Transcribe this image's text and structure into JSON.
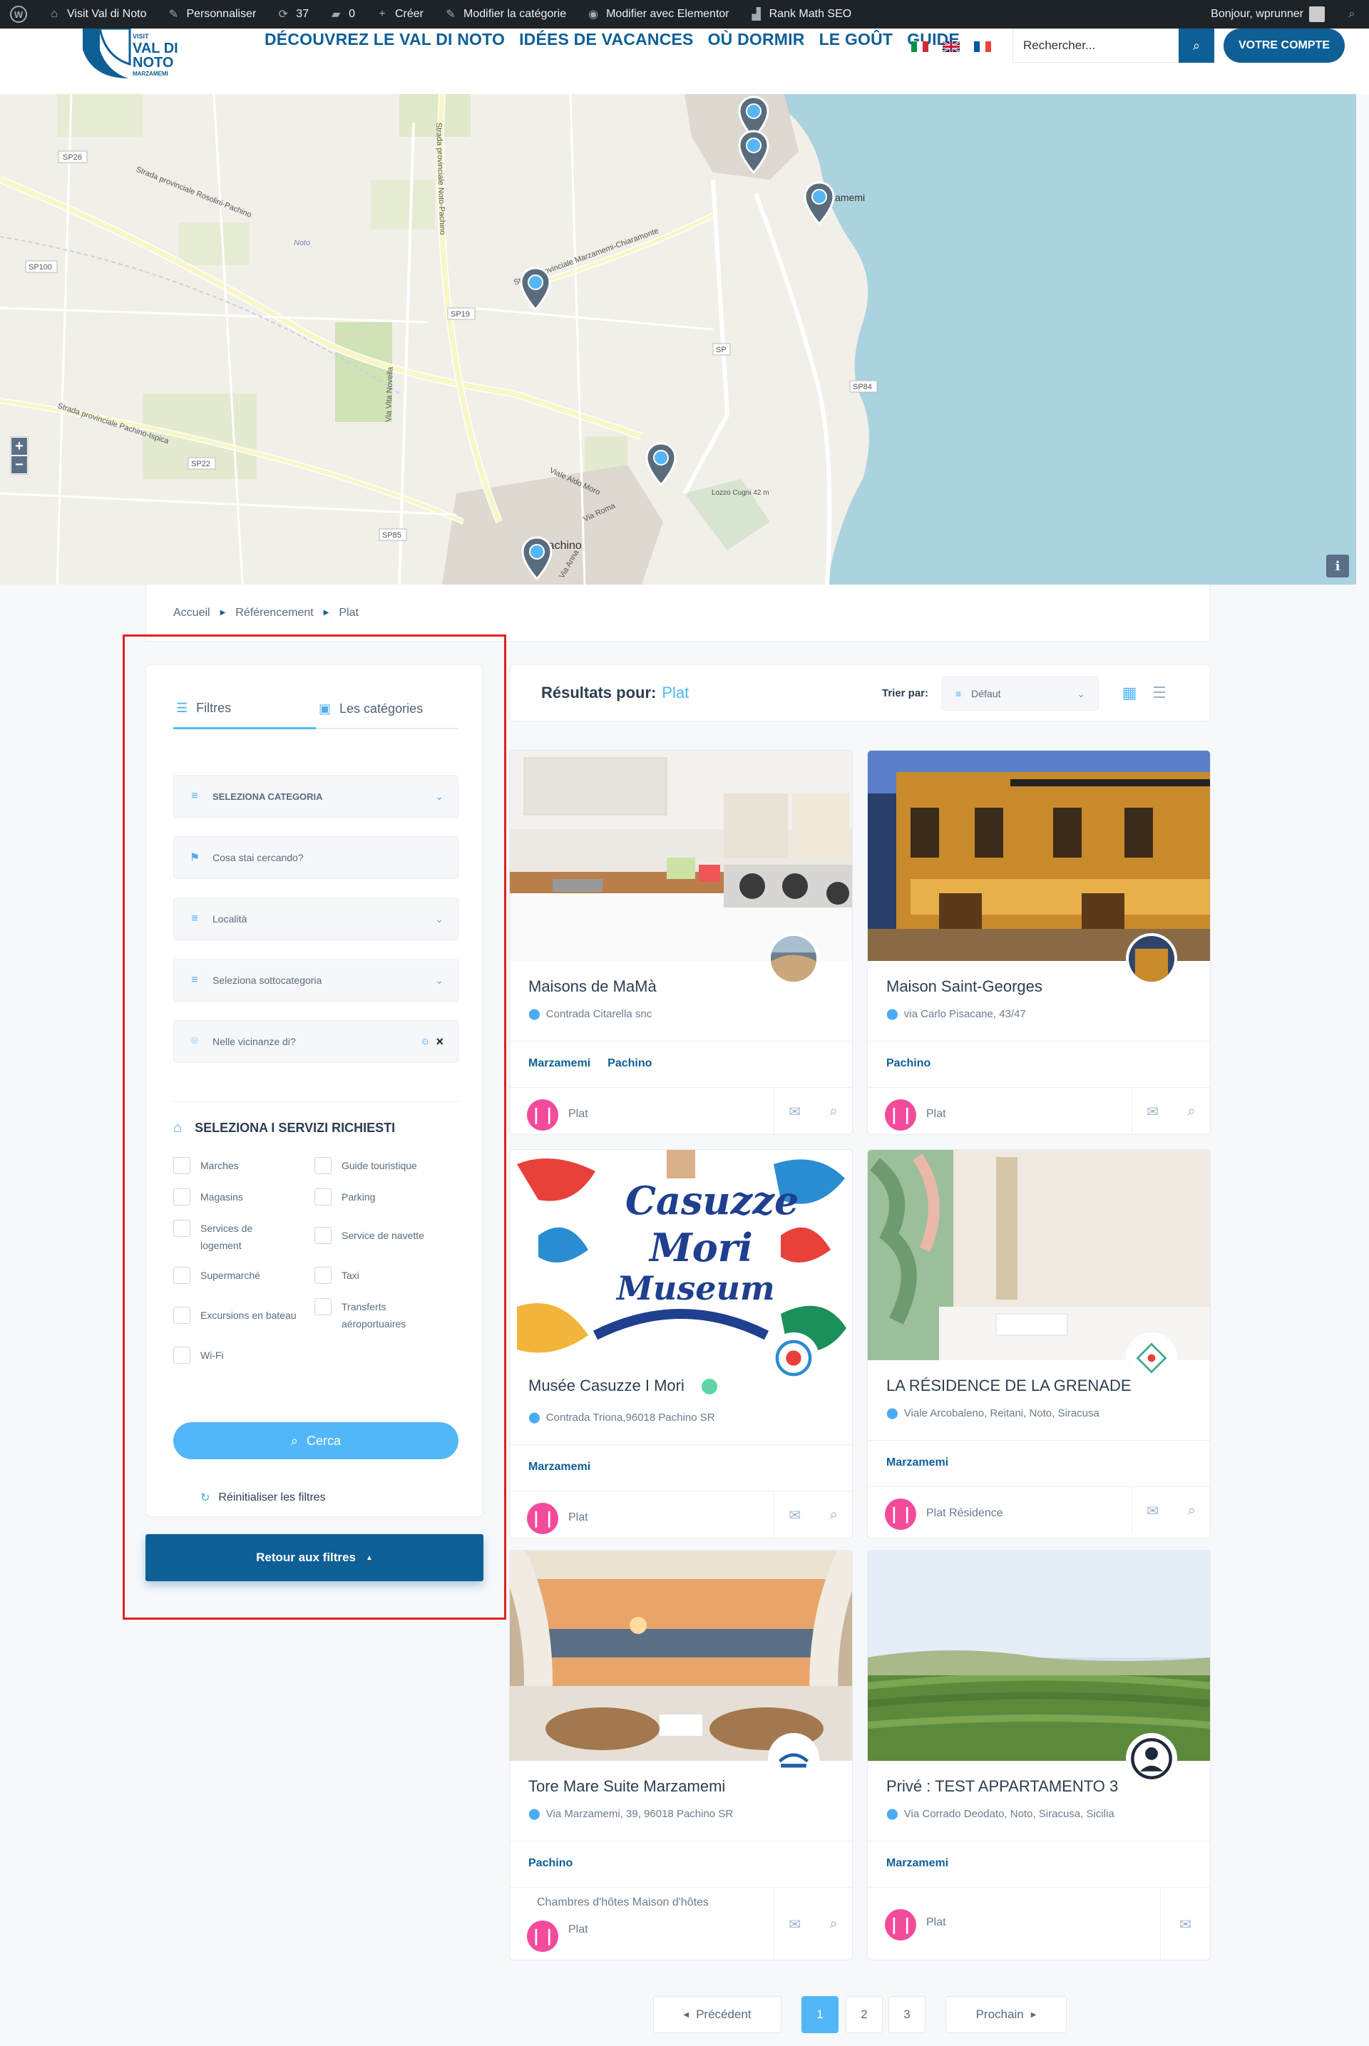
{
  "adminbar": {
    "site": "Visit Val di Noto",
    "customize": "Personnaliser",
    "updates": "37",
    "comments": "0",
    "create": "Créer",
    "edit_category": "Modifier la catégorie",
    "edit_elementor": "Modifier avec Elementor",
    "rank_math": "Rank Math SEO",
    "greeting": "Bonjour, wprunner"
  },
  "header": {
    "logo_top": "VISIT",
    "logo_main1": "VAL DI",
    "logo_main2": "NOTO",
    "logo_sub": "MARZAMEMI",
    "nav": [
      "DÉCOUVREZ LE VAL DI NOTO",
      "IDÉES DE VACANCES",
      "OÙ DORMIR",
      "LE GOÛT",
      "GUIDE"
    ],
    "search_placeholder": "Rechercher...",
    "account": "VOTRE COMPTE"
  },
  "map": {
    "labels": [
      "SP26",
      "SP100",
      "SP19",
      "SP22",
      "SP85",
      "SP",
      "SP84",
      "Noto",
      "Marzamemi",
      "Pachino",
      "Strada provinciale Rosolini-Pachino",
      "Strada provinciale Noto-Pachino",
      "Strada provinciale Marzamemi-Chiaramonte",
      "Strada provinciale Pachino-Ispica",
      "Via Vita Novella",
      "Viale Aldo Moro",
      "Via Roma",
      "Via Anna",
      "Lozzo Cugni 42 m"
    ],
    "zoom_in": "+",
    "zoom_out": "−",
    "info": "i"
  },
  "breadcrumb": [
    "Accueil",
    "Référencement",
    "Plat"
  ],
  "sidebar": {
    "tab_filters": "Filtres",
    "tab_categories": "Les catégories",
    "category_select": "SELEZIONA CATEGORIA",
    "keyword_placeholder": "Cosa stai cercando?",
    "location_select": "Località",
    "subcategory_select": "Seleziona sottocategoria",
    "near_placeholder": "Nelle vicinanze di?",
    "services_title": "SELEZIONA I SERVIZI RICHIESTI",
    "services": [
      "Marches",
      "Guide touristique",
      "Magasins",
      "Parking",
      "Services de logement",
      "Service de navette",
      "Supermarché",
      "Taxi",
      "Excursions en bateau",
      "Transferts aéroportuaires",
      "Wi-Fi"
    ],
    "search_button": "Cerca",
    "reset": "Réinitialiser les filtres",
    "back_button": "Retour aux filtres"
  },
  "results": {
    "label": "Résultats pour:",
    "category": "Plat",
    "sort_label": "Trier par:",
    "sort_value": "Défaut"
  },
  "cards": [
    {
      "title": "Maisons de MaMà",
      "address": "Contrada Citarella snc",
      "locations": [
        "Marzamemi",
        "Pachino"
      ],
      "categories": "Plat"
    },
    {
      "title": "Maison Saint-Georges",
      "address": "via Carlo Pisacane, 43/47",
      "locations": [
        "Pachino"
      ],
      "categories": "Plat"
    },
    {
      "title": "Musée Casuzze I Mori",
      "address": "Contrada Triona,96018 Pachino SR",
      "locations": [
        "Marzamemi"
      ],
      "categories": "Plat",
      "art1": "Casuzze",
      "art2": "Mori",
      "art3": "Museum"
    },
    {
      "title": "LA RÉSIDENCE DE LA GRENADE",
      "address": "Viale Arcobaleno, Reitani, Noto, Siracusa",
      "locations": [
        "Marzamemi"
      ],
      "categories": "Plat  Résidence"
    },
    {
      "title": "Tore Mare Suite Marzamemi",
      "address": "Via Marzamemi, 39, 96018 Pachino SR",
      "locations": [
        "Pachino"
      ],
      "extra_categories": "Chambres d'hôtes  Maison d'hôtes",
      "categories": "Plat"
    },
    {
      "title": "Privé : TEST APPARTAMENTO 3",
      "address": "Via Corrado Deodato, Noto, Siracusa, Sicilia",
      "locations": [
        "Marzamemi"
      ],
      "categories": "Plat"
    }
  ],
  "pagination": {
    "prev": "Précédent",
    "pages": [
      "1",
      "2",
      "3"
    ],
    "next": "Prochain"
  }
}
